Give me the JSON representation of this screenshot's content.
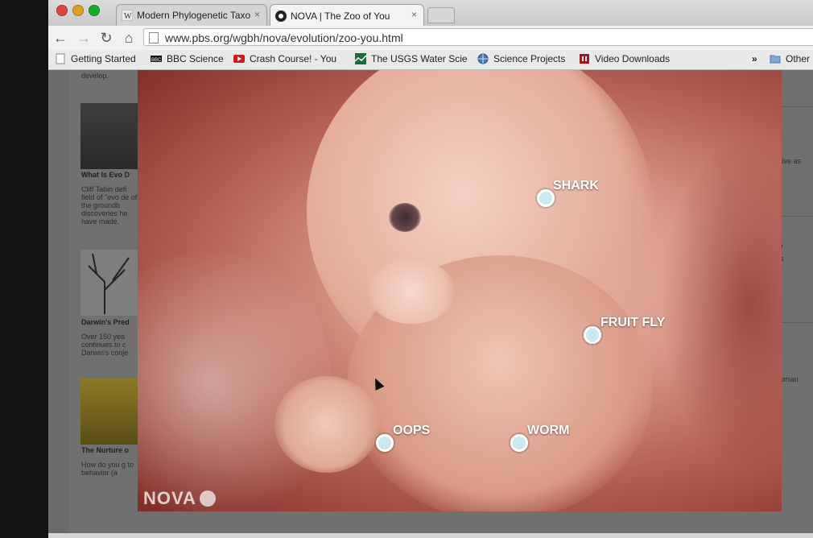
{
  "tabs": [
    {
      "label": "Modern Phylogenetic Taxo",
      "close": "×",
      "active": false
    },
    {
      "label": "NOVA | The Zoo of You",
      "close": "×",
      "active": true
    }
  ],
  "toolbar": {
    "back": "←",
    "forward": "→",
    "reload": "↻",
    "home": "⌂"
  },
  "address": {
    "url": "www.pbs.org/wgbh/nova/evolution/zoo-you.html"
  },
  "bookmarks": [
    {
      "label": "Getting Started",
      "icon": "page-icon"
    },
    {
      "label": "BBC Science",
      "icon": "bbc-icon"
    },
    {
      "label": "Crash Course! - You",
      "icon": "youtube-icon"
    },
    {
      "label": "The USGS Water Scie",
      "icon": "usgs-icon"
    },
    {
      "label": "Science Projects",
      "icon": "globe-icon"
    },
    {
      "label": "Video Downloads",
      "icon": "video-icon"
    }
  ],
  "bookmarks_overflow": "»",
  "other_bookmarks": "Other",
  "side_articles": [
    {
      "title": "",
      "text": "develop."
    },
    {
      "title": "What Is Evo D",
      "text": "Cliff Tabin defi field of \"evo de of the groundb discoveries he have made."
    },
    {
      "title": "Darwin's Pred",
      "text": "Over 150 yea continues to c Darwin's conje"
    },
    {
      "title": "The Nurture o",
      "text": "How do you g to behavior (a"
    }
  ],
  "right_snippets": [
    "ative as",
    "re",
    "as",
    "ur",
    "human"
  ],
  "hotspots": [
    {
      "label": "SHARK"
    },
    {
      "label": "FRUIT FLY"
    },
    {
      "label": "OOPS"
    },
    {
      "label": "WORM"
    }
  ],
  "logo": {
    "text": "NOVA"
  },
  "colors": {
    "hotspot_fill": "#c9e9f0",
    "hotspot_ring": "#ffffff",
    "video_dark": "#7e2a25"
  }
}
